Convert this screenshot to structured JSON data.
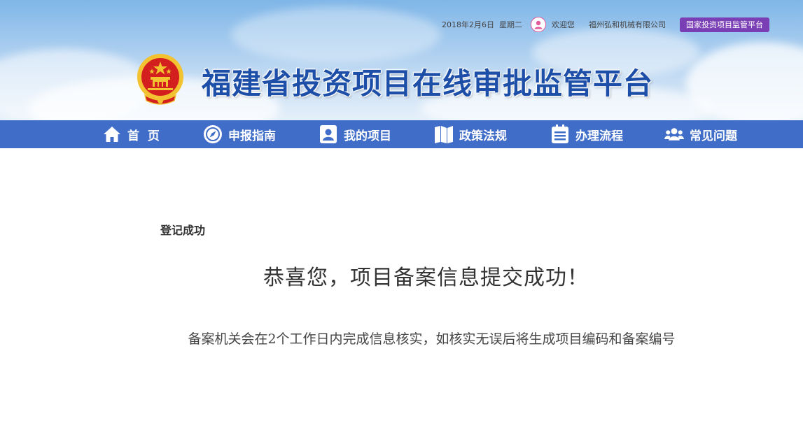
{
  "header": {
    "date": "2018年2月6日",
    "weekday": "星期二",
    "welcome": "欢迎您",
    "company": "福州弘和机械有限公司",
    "national_platform_button": "国家投资项目监管平台",
    "site_title": "福建省投资项目在线审批监管平台",
    "emblem_icon": "national-emblem-icon",
    "avatar_icon": "user-avatar-icon"
  },
  "nav": {
    "items": [
      {
        "label": "首  页",
        "icon": "home-icon"
      },
      {
        "label": "申报指南",
        "icon": "compass-icon"
      },
      {
        "label": "我的项目",
        "icon": "user-card-icon"
      },
      {
        "label": "政策法规",
        "icon": "book-map-icon"
      },
      {
        "label": "办理流程",
        "icon": "clipboard-list-icon"
      },
      {
        "label": "常见问题",
        "icon": "users-icon"
      }
    ]
  },
  "content": {
    "section_label": "登记成功",
    "success_title": "恭喜您，项目备案信息提交成功！",
    "success_desc": "备案机关会在2个工作日内完成信息核实，如核实无误后将生成项目编码和备案编号"
  },
  "colors": {
    "nav_bg": "#3f6dc8",
    "title_blue": "#1d4fa8",
    "button_purple": "#7a3fb5",
    "emblem_red": "#d3201e",
    "emblem_gold": "#f2c230"
  }
}
